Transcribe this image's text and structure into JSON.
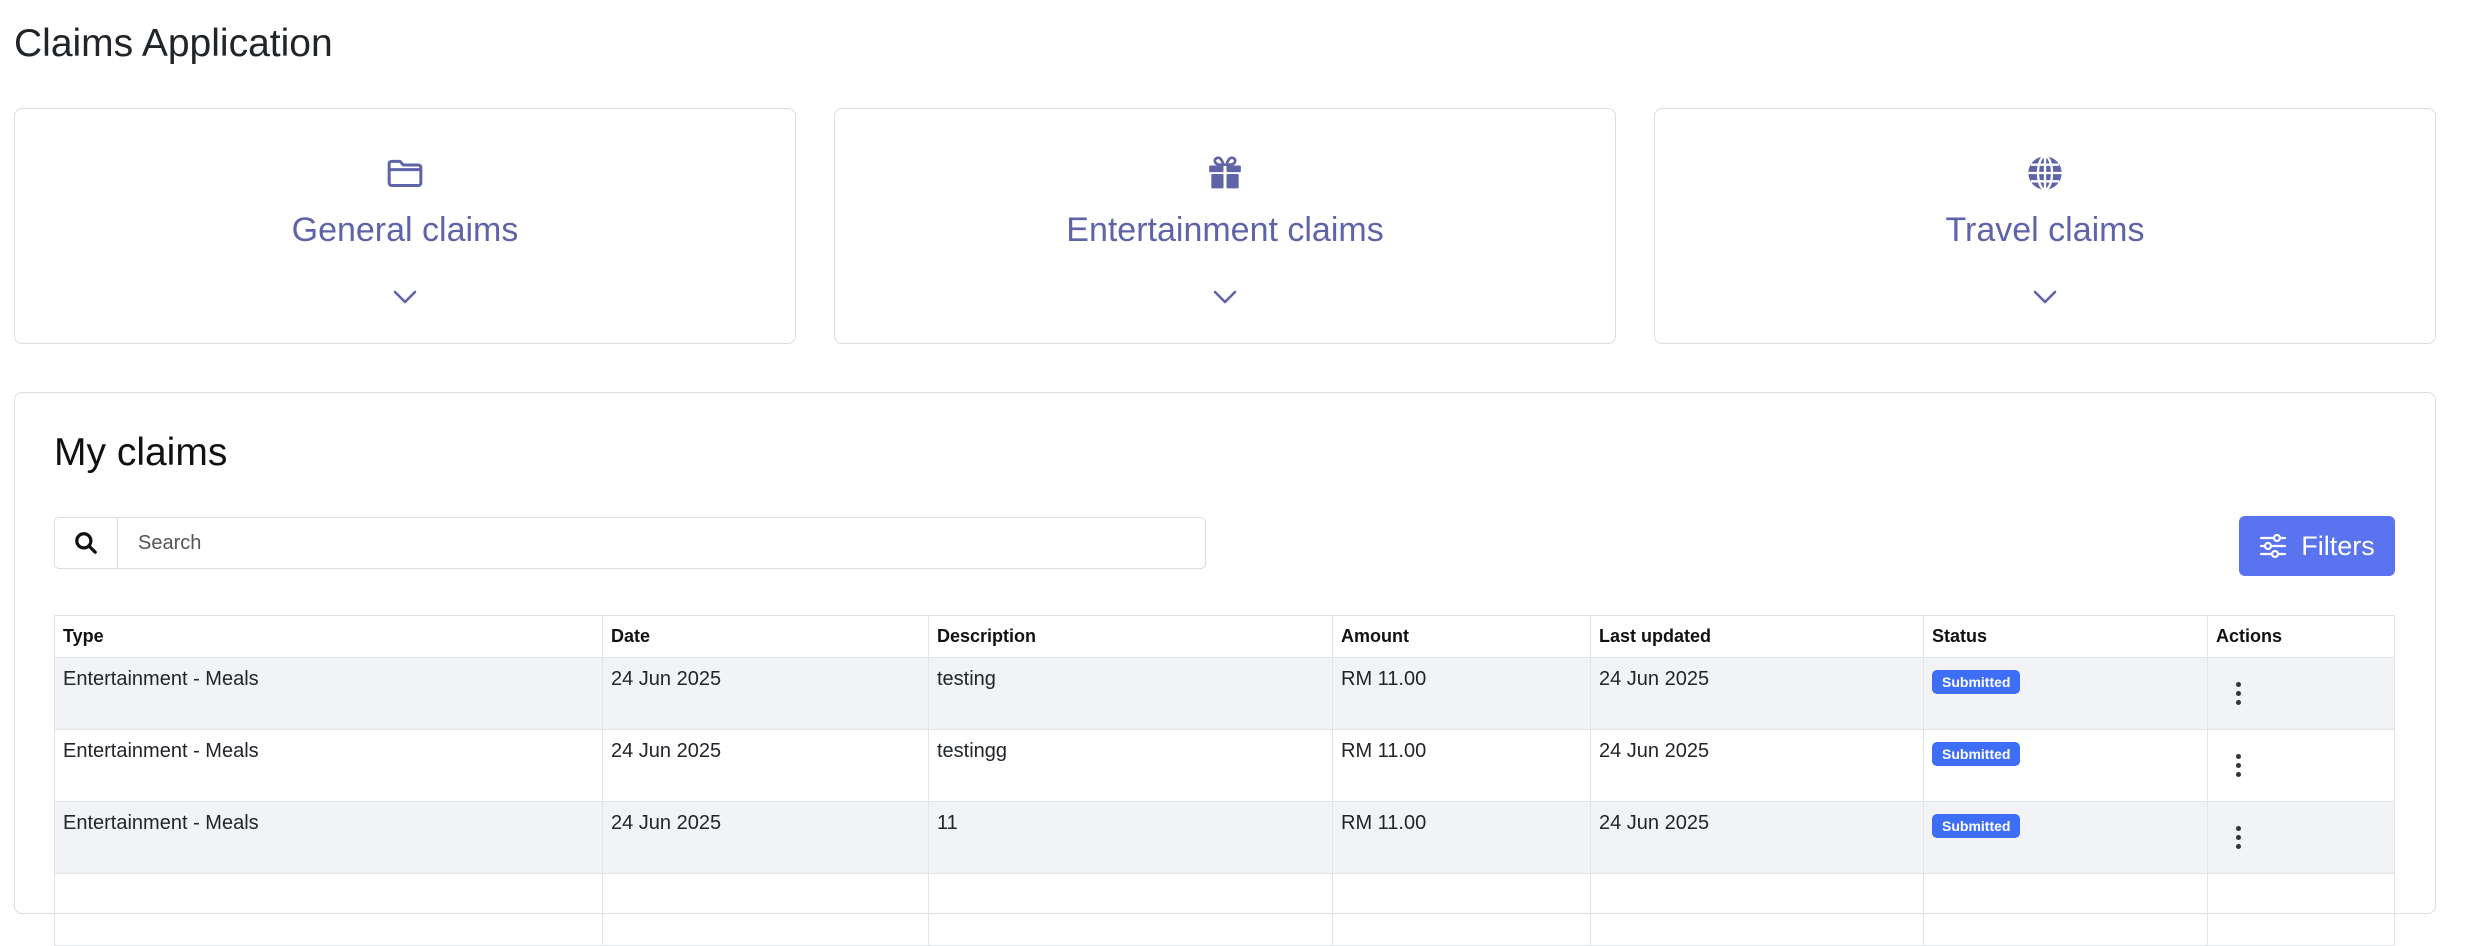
{
  "app": {
    "title": "Claims Application"
  },
  "categories": [
    {
      "label": "General claims",
      "icon": "folder-icon"
    },
    {
      "label": "Entertainment claims",
      "icon": "gift-icon"
    },
    {
      "label": "Travel claims",
      "icon": "globe-icon"
    }
  ],
  "my_claims": {
    "title": "My claims",
    "search": {
      "placeholder": "Search",
      "value": ""
    },
    "filters_label": "Filters",
    "columns": [
      "Type",
      "Date",
      "Description",
      "Amount",
      "Last updated",
      "Status",
      "Actions"
    ],
    "rows": [
      {
        "type": "Entertainment - Meals",
        "date": "24 Jun 2025",
        "description": "testing",
        "amount": "RM 11.00",
        "last_updated": "24 Jun 2025",
        "status": "Submitted"
      },
      {
        "type": "Entertainment - Meals",
        "date": "24 Jun 2025",
        "description": "testingg",
        "amount": "RM 11.00",
        "last_updated": "24 Jun 2025",
        "status": "Submitted"
      },
      {
        "type": "Entertainment - Meals",
        "date": "24 Jun 2025",
        "description": "11",
        "amount": "RM 11.00",
        "last_updated": "24 Jun 2025",
        "status": "Submitted"
      },
      {
        "type": "",
        "date": "",
        "description": "",
        "amount": "",
        "last_updated": "",
        "status": ""
      }
    ]
  },
  "colors": {
    "accent": "#5f63a8",
    "primary_button": "#5a73ee",
    "badge": "#3d6ef5"
  }
}
